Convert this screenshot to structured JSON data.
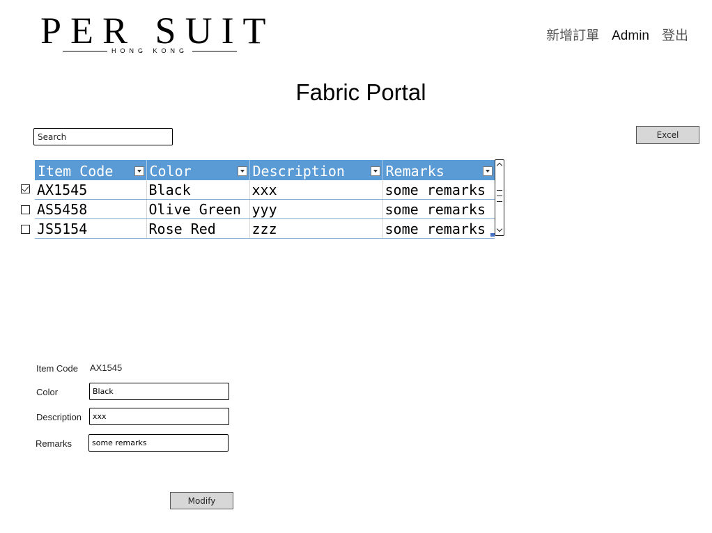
{
  "logo": {
    "main": "PER SUIT",
    "sub": "HONG KONG"
  },
  "nav": {
    "new_order": "新增訂單",
    "admin": "Admin",
    "logout": "登出"
  },
  "page": {
    "title": "Fabric Portal"
  },
  "search": {
    "placeholder": "Search",
    "value": ""
  },
  "toolbar": {
    "excel_label": "Excel"
  },
  "table": {
    "columns": [
      "Item Code",
      "Color",
      "Description",
      "Remarks"
    ],
    "rows": [
      {
        "checked": true,
        "cells": [
          "AX1545",
          "Black",
          "xxx",
          "some remarks"
        ]
      },
      {
        "checked": false,
        "cells": [
          "AS5458",
          "Olive Green",
          "yyy",
          "some remarks"
        ]
      },
      {
        "checked": false,
        "cells": [
          "JS5154",
          "Rose Red",
          "zzz",
          "some remarks"
        ]
      }
    ]
  },
  "detail": {
    "item_code_label": "Item Code",
    "item_code_value": "AX1545",
    "color_label": "Color",
    "color_value": "Black",
    "description_label": "Description",
    "description_value": "xxx",
    "remarks_label": "Remarks",
    "remarks_value": "some remarks",
    "modify_label": "Modify"
  },
  "colors": {
    "header_bg": "#5b9bd5",
    "header_text": "#ffffff",
    "button_bg": "#d7d7d7",
    "row_border": "#7fa8cf"
  },
  "icons": {
    "filter": "dropdown-filter-icon",
    "checkbox": "checkbox-icon",
    "scroll_up": "chevron-up-icon",
    "scroll_down": "chevron-down-icon"
  }
}
